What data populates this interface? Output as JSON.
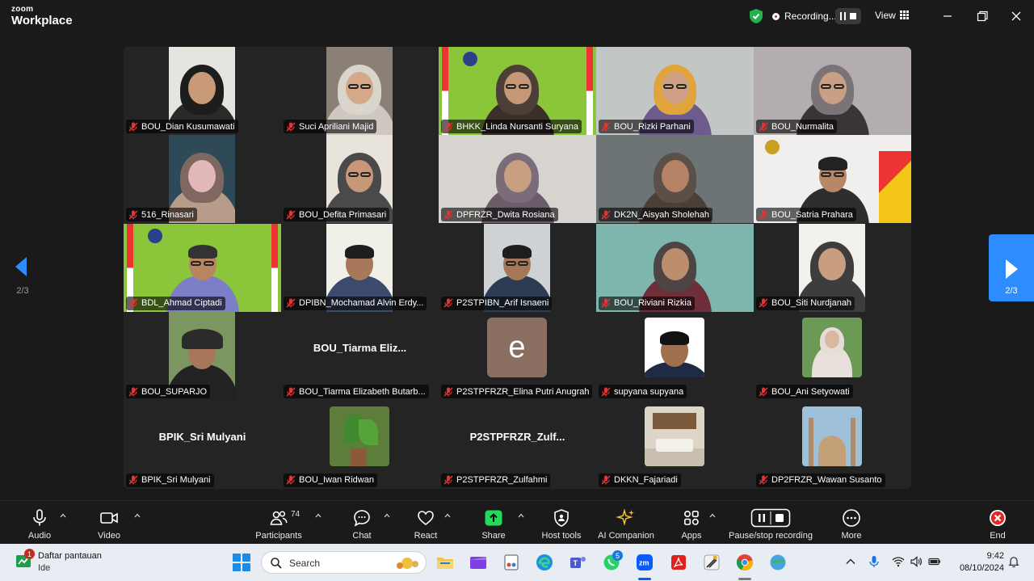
{
  "app": {
    "brand_small": "zoom",
    "brand_large": "Workplace"
  },
  "titlebar": {
    "recording_label": "Recording...",
    "view_label": "View"
  },
  "gallery": {
    "page_left": "2/3",
    "page_right": "2/3",
    "tiles": [
      {
        "name": "BOU_Dian Kusumawati"
      },
      {
        "name": "Suci Apriliani Majid"
      },
      {
        "name": "BHKK_Linda Nursanti Suryana"
      },
      {
        "name": "BOU_Rizki Parhani"
      },
      {
        "name": "BOU_Nurmalita"
      },
      {
        "name": "516_Rinasari"
      },
      {
        "name": "BOU_Defita Primasari"
      },
      {
        "name": "DPFRZR_Dwita Rosiana"
      },
      {
        "name": "DK2N_Aisyah Sholehah"
      },
      {
        "name": "BOU_Satria Prahara"
      },
      {
        "name": "BDL_Ahmad Ciptadi"
      },
      {
        "name": "DPIBN_Mochamad Alvin Erdy..."
      },
      {
        "name": "P2STPIBN_Arif Isnaeni"
      },
      {
        "name": "BOU_Riviani Rizkia"
      },
      {
        "name": "BOU_Siti Nurdjanah"
      },
      {
        "name": "BOU_SUPARJO"
      },
      {
        "name": "BOU_Tiarma Elizabeth Butarb...",
        "big": "BOU_Tiarma  Eliz..."
      },
      {
        "name": "P2STPFRZR_Elina Putri Anugrah",
        "initial": "e"
      },
      {
        "name": "supyana supyana"
      },
      {
        "name": "BOU_Ani Setyowati"
      },
      {
        "name": "BPIK_Sri Mulyani",
        "big": "BPIK_Sri Mulyani"
      },
      {
        "name": "BOU_Iwan Ridwan"
      },
      {
        "name": "P2STPFRZR_Zulfahmi",
        "big": "P2STPFRZR_Zulf..."
      },
      {
        "name": "DKKN_Fajariadi"
      },
      {
        "name": "DP2FRZR_Wawan Susanto"
      }
    ]
  },
  "toolbar": {
    "audio": "Audio",
    "video": "Video",
    "participants": "Participants",
    "participants_count": "74",
    "chat": "Chat",
    "react": "React",
    "share": "Share",
    "host_tools": "Host tools",
    "ai_companion": "AI Companion",
    "apps": "Apps",
    "pause_stop": "Pause/stop recording",
    "more": "More",
    "end": "End"
  },
  "taskbar": {
    "widget_title": "Daftar pantauan",
    "widget_sub": "Ide",
    "widget_badge": "1",
    "search_placeholder": "Search",
    "whatsapp_badge": "5",
    "time": "9:42",
    "date": "08/10/2024"
  },
  "colors": {
    "accent": "#2d8cff",
    "end_red": "#e02828",
    "share_green": "#23d959",
    "mic_off_red": "#e03535"
  }
}
